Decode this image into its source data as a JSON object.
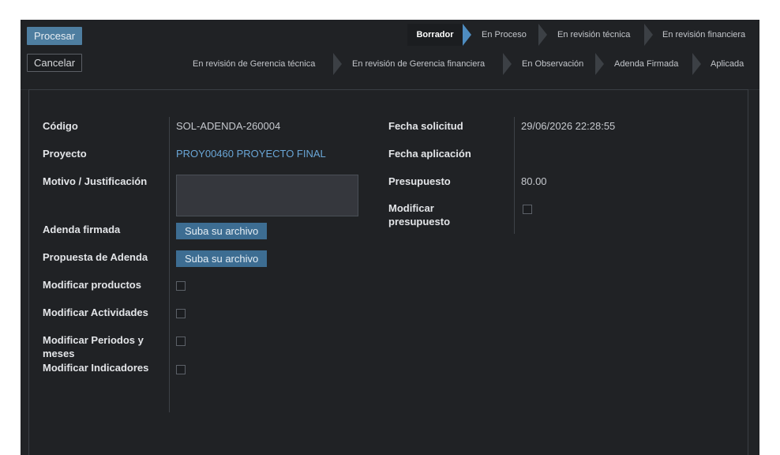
{
  "buttons": {
    "procesar": "Procesar",
    "cancelar": "Cancelar"
  },
  "stages_row1": [
    "Borrador",
    "En Proceso",
    "En revisión técnica",
    "En revisión financiera"
  ],
  "stages_row2": [
    "En revisión de Gerencia técnica",
    "En revisión de Gerencia financiera",
    "En Observación",
    "Adenda Firmada",
    "Aplicada"
  ],
  "active_stage": "Borrador",
  "form": {
    "codigo": {
      "label": "Código",
      "value": "SOL-ADENDA-260004"
    },
    "proyecto": {
      "label": "Proyecto",
      "value": "PROY00460 PROYECTO FINAL"
    },
    "motivo": {
      "label": "Motivo / Justificación",
      "value": ""
    },
    "adenda_firmada": {
      "label": "Adenda firmada",
      "button": "Suba su archivo"
    },
    "propuesta_adenda": {
      "label": "Propuesta de Adenda",
      "button": "Suba su archivo"
    },
    "modificar_productos": {
      "label": "Modificar productos",
      "checked": false
    },
    "modificar_actividades": {
      "label": "Modificar Actividades",
      "checked": false
    },
    "modificar_periodos": {
      "label_line1": "Modificar Periodos y",
      "label_line2": "meses",
      "checked": false
    },
    "modificar_indicadores": {
      "label": "Modificar Indicadores",
      "checked": false
    },
    "fecha_solicitud": {
      "label": "Fecha solicitud",
      "value": "29/06/2026 22:28:55"
    },
    "fecha_aplicacion": {
      "label": "Fecha aplicación",
      "value": ""
    },
    "presupuesto": {
      "label": "Presupuesto",
      "value": "80.00"
    },
    "modificar_presupuesto": {
      "label_line1": "Modificar",
      "label_line2": "presupuesto",
      "checked": false
    }
  },
  "colors": {
    "background": "#212326",
    "primary": "#4e7ea0",
    "link": "#6aa6d6",
    "text": "#e3e5e8"
  }
}
